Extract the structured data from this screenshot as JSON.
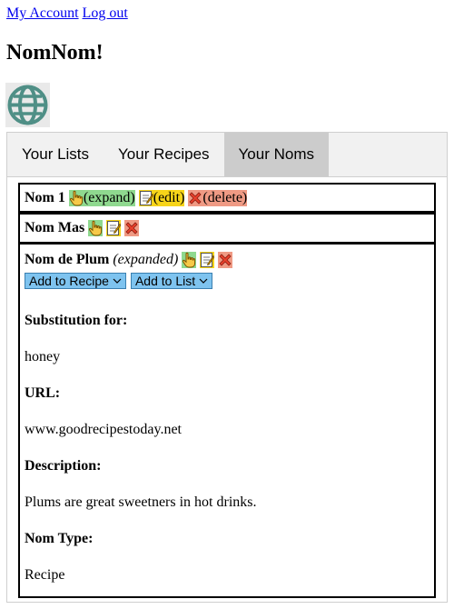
{
  "header": {
    "my_account_label": "My Account",
    "logout_label": "Log out",
    "site_title": "NomNom!"
  },
  "tabs": [
    {
      "label": "Your Lists",
      "active": false
    },
    {
      "label": "Your Recipes",
      "active": false
    },
    {
      "label": "Your Noms",
      "active": true
    }
  ],
  "noms": [
    {
      "name": "Nom 1",
      "expand_label": "(expand)",
      "edit_label": "(edit)",
      "delete_label": "(delete)"
    },
    {
      "name": "Nom Mas"
    },
    {
      "name": "Nom de Plum",
      "status": "(expanded)",
      "add_to_recipe": "Add to Recipe",
      "add_to_list": "Add to List",
      "details": [
        {
          "label": "Substitution for:",
          "value": "honey"
        },
        {
          "label": "URL:",
          "value": "www.goodrecipestoday.net"
        },
        {
          "label": "Description:",
          "value": "Plums are great sweetners in hot drinks."
        },
        {
          "label": "Nom Type:",
          "value": "Recipe"
        }
      ]
    }
  ],
  "icons": {
    "logo": "globe-icon",
    "expand": "pointing-hand-icon",
    "edit": "memo-icon",
    "delete": "cross-mark-icon"
  },
  "colors": {
    "expand_bg": "#8fd98f",
    "edit_bg": "#f7d419",
    "delete_bg": "#ef9a84",
    "dropdown_bg": "#7ec3ef",
    "active_tab_bg": "#cccccc",
    "link": "#0000ee",
    "logo": "#4f8f86"
  }
}
